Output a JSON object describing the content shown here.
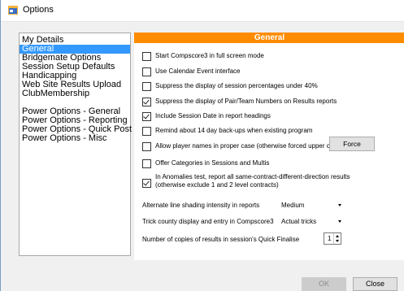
{
  "window": {
    "title": "Options",
    "icon": "app-icon"
  },
  "nav": {
    "items": [
      {
        "label": "My Details",
        "selected": false
      },
      {
        "label": "General",
        "selected": true
      },
      {
        "label": "Bridgemate Options",
        "selected": false
      },
      {
        "label": "Session Setup Defaults",
        "selected": false
      },
      {
        "label": "Handicapping",
        "selected": false
      },
      {
        "label": "Web Site Results Upload",
        "selected": false
      },
      {
        "label": "ClubMembership",
        "selected": false
      },
      {
        "label": "Power Options - General",
        "selected": false
      },
      {
        "label": "Power Options - Reporting",
        "selected": false
      },
      {
        "label": "Power Options - Quick Post",
        "selected": false
      },
      {
        "label": "Power Options - Misc",
        "selected": false
      }
    ]
  },
  "panel": {
    "header": "General",
    "header_color": "#ff8c00",
    "checkboxes": [
      {
        "label": "Start Compscore3 in full screen mode",
        "checked": false
      },
      {
        "label": "Use Calendar Event interface",
        "checked": false
      },
      {
        "label": "Suppress the display of session percentages under 40%",
        "checked": false
      },
      {
        "label": "Suppress the display of Pair/Team Numbers on Results reports",
        "checked": true
      },
      {
        "label": "Include Session Date in report headings",
        "checked": true
      },
      {
        "label": "Remind about 14 day back-ups when existing program",
        "checked": false
      },
      {
        "label": "Allow player names in proper case (otherwise forced upper case)",
        "checked": false
      },
      {
        "label": "Offer Categories in Sessions and Multis",
        "checked": false
      },
      {
        "label": "In Anomalies test, report all same-contract-different-direction results (otherwise exclude 1 and 2 level contracts)",
        "checked": true
      }
    ],
    "force_button": "Force",
    "shading": {
      "label": "Alternate line shading intensity in reports",
      "value": "Medium"
    },
    "trick_display": {
      "label": "Trick county display and entry in Compscore3",
      "value": "Actual tricks"
    },
    "copies": {
      "label": "Number of copies of results in session's Quick Finalise",
      "value": "1"
    }
  },
  "footer": {
    "ok_label": "OK",
    "close_label": "Close"
  }
}
